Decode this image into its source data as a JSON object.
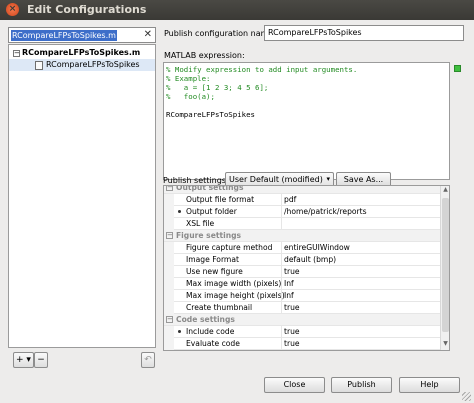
{
  "window": {
    "title": "Edit Configurations",
    "close_glyph": "×"
  },
  "left_panel": {
    "search_value": "RCompareLFPsToSpikes.m",
    "search_clear_glyph": "✕",
    "tree": {
      "root_toggle": "−",
      "root_label": "RCompareLFPsToSpikes.m",
      "child_label": "RCompareLFPsToSpikes"
    },
    "add_label": "+ ▾",
    "remove_label": "−",
    "revert_glyph": "↶"
  },
  "right_panel": {
    "publish_name_label": "Publish configuration name:",
    "publish_name_value": "RCompareLFPsToSpikes",
    "matlab_expression_label": "MATLAB expression:",
    "code_lines": [
      "% Modify expression to add input arguments.",
      "% Example:",
      "%   a = [1 2 3; 4 5 6];",
      "%   foo(a);"
    ],
    "code_call": "RCompareLFPsToSpikes",
    "publish_settings_label": "Publish settings:",
    "publish_settings_value": "User Default (modified)",
    "select_arrow": "▾",
    "save_as_label": "Save As...",
    "settings": {
      "output_header": "Output settings",
      "output_file_format_key": "Output file format",
      "output_file_format_val": "pdf",
      "output_folder_key": "Output folder",
      "output_folder_val": "/home/patrick/reports",
      "xsl_file_key": "XSL file",
      "xsl_file_val": "",
      "figure_header": "Figure settings",
      "figure_capture_key": "Figure capture method",
      "figure_capture_val": "entireGUIWindow",
      "image_format_key": "Image Format",
      "image_format_val": "default (bmp)",
      "use_new_figure_key": "Use new figure",
      "use_new_figure_val": "true",
      "max_width_key": "Max image width (pixels)",
      "max_width_val": "Inf",
      "max_height_key": "Max image height (pixels)",
      "max_height_val": "Inf",
      "create_thumbnail_key": "Create thumbnail",
      "create_thumbnail_val": "true",
      "code_header": "Code settings",
      "include_code_key": "Include code",
      "include_code_val": "true",
      "evaluate_code_key": "Evaluate code",
      "evaluate_code_val": "true"
    },
    "section_toggle": "−"
  },
  "buttons": {
    "close": "Close",
    "publish": "Publish",
    "help": "Help"
  },
  "colors": {
    "selection": "#3d6ec9",
    "comment": "#228b22",
    "status": "#3fbf3f"
  }
}
